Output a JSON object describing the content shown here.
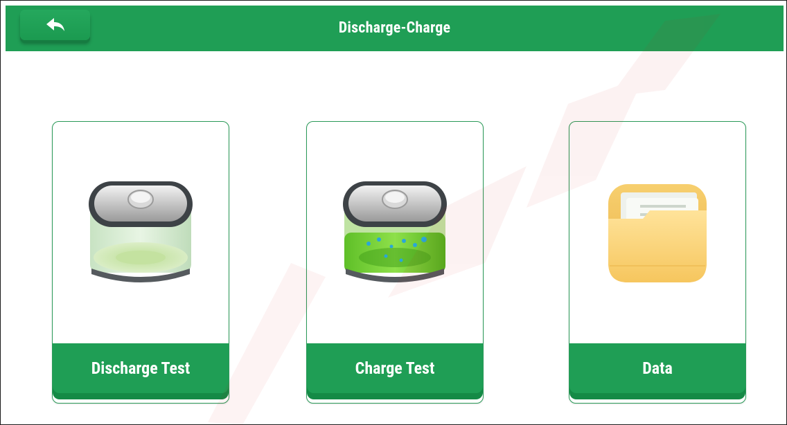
{
  "header": {
    "title": "Discharge-Charge",
    "back_icon": "back-arrow-icon"
  },
  "cards": [
    {
      "label": "Discharge Test",
      "icon": "battery-empty-icon"
    },
    {
      "label": "Charge Test",
      "icon": "battery-charging-icon"
    },
    {
      "label": "Data",
      "icon": "folder-icon"
    }
  ],
  "colors": {
    "accent": "#1f9e55",
    "accent_dark": "#158a46"
  }
}
